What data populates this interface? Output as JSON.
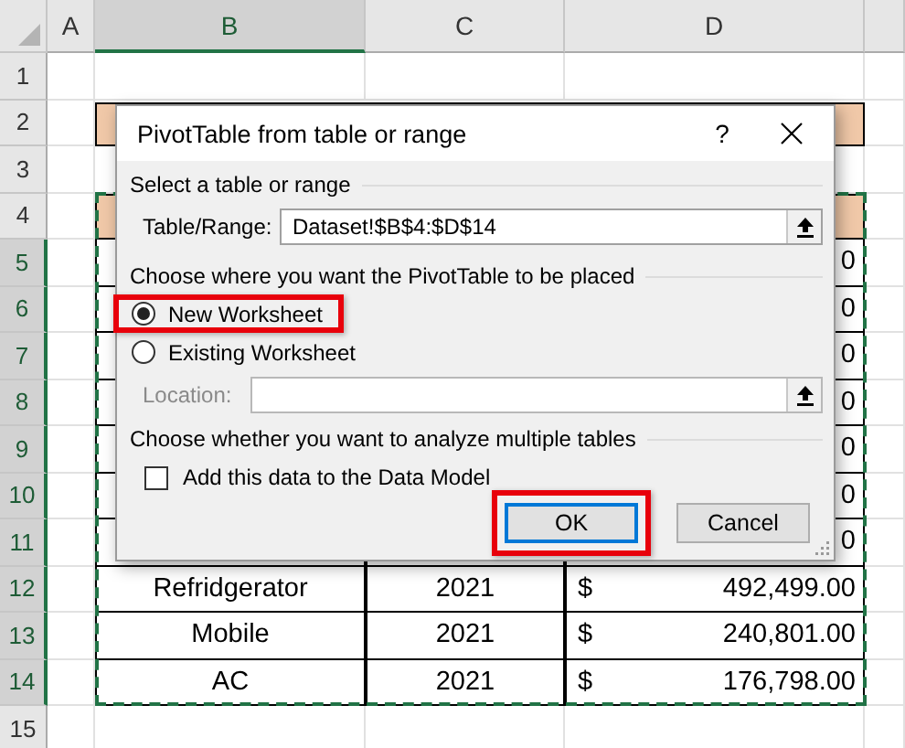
{
  "sheet": {
    "columns": [
      {
        "label": "A",
        "selected": false
      },
      {
        "label": "B",
        "selected": true
      },
      {
        "label": "C",
        "selected": false
      },
      {
        "label": "D",
        "selected": false
      }
    ],
    "rows": [
      {
        "number": "1",
        "selected": false,
        "kind": "empty"
      },
      {
        "number": "2",
        "selected": false,
        "kind": "title"
      },
      {
        "number": "3",
        "selected": false,
        "kind": "empty"
      },
      {
        "number": "4",
        "selected": false,
        "kind": "header"
      },
      {
        "number": "5",
        "selected": true,
        "kind": "data",
        "amount": "0"
      },
      {
        "number": "6",
        "selected": true,
        "kind": "data",
        "amount": "0"
      },
      {
        "number": "7",
        "selected": true,
        "kind": "data",
        "amount": "0"
      },
      {
        "number": "8",
        "selected": true,
        "kind": "data",
        "amount": "0"
      },
      {
        "number": "9",
        "selected": true,
        "kind": "data",
        "amount": "0"
      },
      {
        "number": "10",
        "selected": true,
        "kind": "data",
        "amount": "0"
      },
      {
        "number": "11",
        "selected": true,
        "kind": "data",
        "amount": "0"
      },
      {
        "number": "12",
        "selected": true,
        "kind": "data",
        "product": "Refridgerator",
        "year": "2021",
        "currency": "$",
        "amount": "492,499.00"
      },
      {
        "number": "13",
        "selected": true,
        "kind": "data",
        "product": "Mobile",
        "year": "2021",
        "currency": "$",
        "amount": "240,801.00"
      },
      {
        "number": "14",
        "selected": true,
        "kind": "data",
        "product": "AC",
        "year": "2021",
        "currency": "$",
        "amount": "176,798.00"
      },
      {
        "number": "15",
        "selected": false,
        "kind": "empty"
      }
    ]
  },
  "dialog": {
    "title": "PivotTable from table or range",
    "help": "?",
    "source_section": "Select a table or range",
    "range_label": "Table/Range:",
    "range_value": "Dataset!$B$4:$D$14",
    "place_section": "Choose where you want the PivotTable to be placed",
    "placements": [
      {
        "label": "New Worksheet",
        "selected": true,
        "highlighted": true
      },
      {
        "label": "Existing Worksheet",
        "selected": false,
        "highlighted": false
      }
    ],
    "location": {
      "label": "Location:",
      "disabled": true
    },
    "multiple_section": "Choose whether you want to analyze multiple tables",
    "data_model": {
      "label": "Add this data to the Data Model",
      "checked": false
    },
    "buttons": [
      {
        "label": "OK",
        "default": true,
        "highlighted": true
      },
      {
        "label": "Cancel",
        "default": false,
        "highlighted": false
      }
    ]
  }
}
